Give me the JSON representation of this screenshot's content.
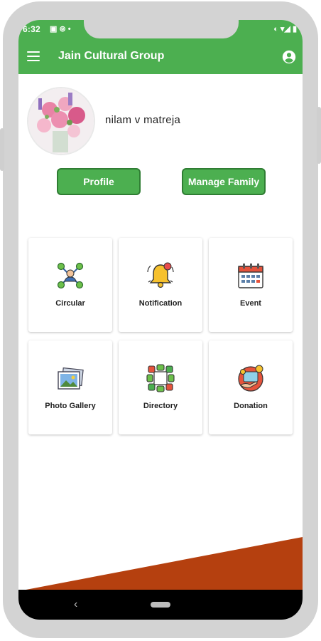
{
  "status_bar": {
    "time": "6:32",
    "left_icons": "▣ ⊚ •",
    "right_icons": "◐ ▾◢ ▮"
  },
  "app_bar": {
    "title": "Jain Cultural Group",
    "menu_icon": "menu-icon",
    "account_icon": "account-circle-icon"
  },
  "profile": {
    "name": "nilam v matreja"
  },
  "buttons": {
    "profile": "Profile",
    "manage_family": "Manage Family"
  },
  "menu": [
    {
      "label": "Circular",
      "icon": "network-people-icon"
    },
    {
      "label": "Notification",
      "icon": "bell-icon"
    },
    {
      "label": "Event",
      "icon": "calendar-icon"
    },
    {
      "label": "Photo Gallery",
      "icon": "photo-gallery-icon"
    },
    {
      "label": "Directory",
      "icon": "directory-icon"
    },
    {
      "label": "Donation",
      "icon": "donation-icon"
    }
  ],
  "colors": {
    "primary": "#4caf50",
    "primary_dark": "#2f7d33",
    "accent_wedge": "#b5400f",
    "frame": "#d3d3d3"
  }
}
